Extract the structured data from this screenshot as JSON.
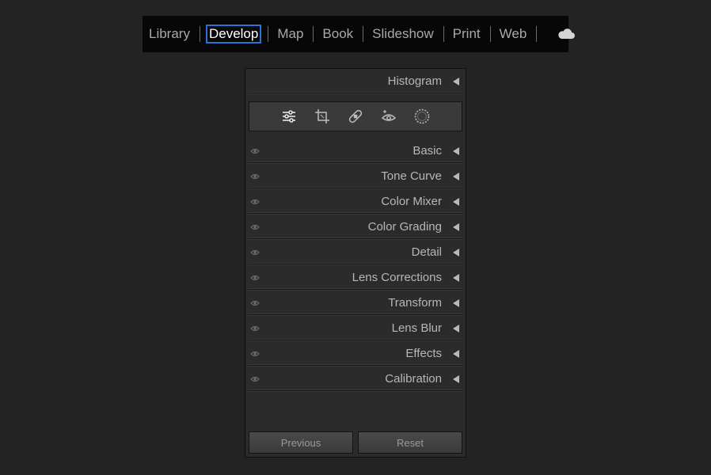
{
  "modules": [
    {
      "label": "Library",
      "active": false
    },
    {
      "label": "Develop",
      "active": true
    },
    {
      "label": "Map",
      "active": false
    },
    {
      "label": "Book",
      "active": false
    },
    {
      "label": "Slideshow",
      "active": false
    },
    {
      "label": "Print",
      "active": false
    },
    {
      "label": "Web",
      "active": false
    }
  ],
  "cloud_icon": "cloud-icon",
  "panel": {
    "histogram_label": "Histogram",
    "tools": [
      {
        "name": "edit-sliders-icon"
      },
      {
        "name": "crop-icon"
      },
      {
        "name": "healing-bandage-icon"
      },
      {
        "name": "red-eye-icon"
      },
      {
        "name": "masking-icon"
      }
    ],
    "sections": [
      {
        "label": "Basic"
      },
      {
        "label": "Tone Curve"
      },
      {
        "label": "Color Mixer"
      },
      {
        "label": "Color Grading"
      },
      {
        "label": "Detail"
      },
      {
        "label": "Lens Corrections"
      },
      {
        "label": "Transform"
      },
      {
        "label": "Lens Blur"
      },
      {
        "label": "Effects"
      },
      {
        "label": "Calibration"
      }
    ],
    "previous_label": "Previous",
    "reset_label": "Reset"
  },
  "colors": {
    "background": "#232323",
    "module_bar": "#070707",
    "active_outline": "#2f6fd8",
    "panel": "#2b2b2b"
  }
}
